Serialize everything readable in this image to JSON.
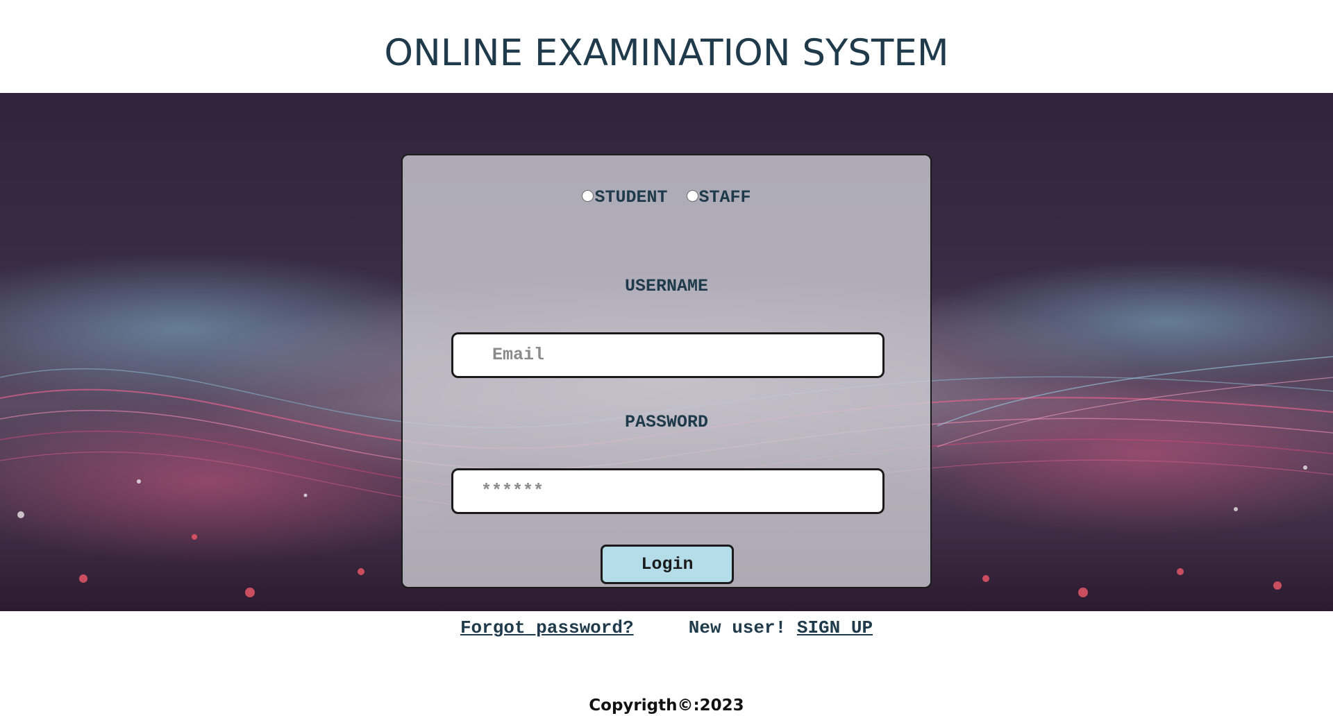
{
  "header": {
    "title": "ONLINE EXAMINATION SYSTEM"
  },
  "login": {
    "roles": [
      {
        "label": "STUDENT",
        "selected": false
      },
      {
        "label": "STAFF",
        "selected": false
      }
    ],
    "username_label": "USERNAME",
    "email_placeholder": "Email",
    "password_label": "PASSWORD",
    "password_placeholder": "******",
    "login_button": "Login"
  },
  "links": {
    "forgot_password": "Forgot password?",
    "new_user_text": "New user!",
    "signup": "SIGN UP"
  },
  "footer": {
    "copyright": "Copyrigth©:2023"
  },
  "colors": {
    "title_text": "#1f3a4a",
    "banner_bg": "#31233a",
    "button_bg": "#b4dde9",
    "card_bg": "#cdcdd4"
  }
}
